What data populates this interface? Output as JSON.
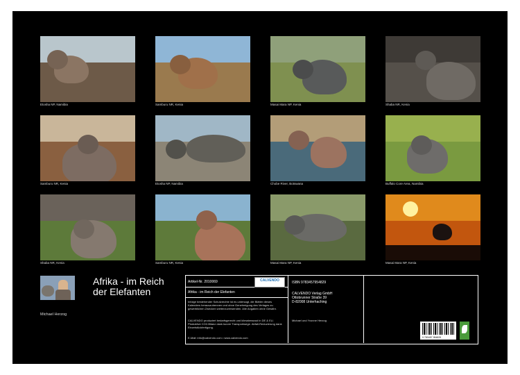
{
  "tiles": [
    {
      "caption": "Etosha NP, Namibia",
      "sky": "#b9c6cc",
      "ground": "#6d5a48",
      "ele": "#8b7563"
    },
    {
      "caption": "Samburu NR, Kenia",
      "sky": "#8fb6d6",
      "ground": "#9a7a4e",
      "ele": "#a0704a"
    },
    {
      "caption": "Masai Mara NP, Kenia",
      "sky": "#8fa07a",
      "ground": "#7f9050",
      "ele": "#585a5a"
    },
    {
      "caption": "Shaba NR, Kenia",
      "sky": "#3e3a36",
      "ground": "#55504a",
      "ele": "#6f6a64"
    },
    {
      "caption": "Samburu NR, Kenia",
      "sky": "#c9b69a",
      "ground": "#8a6040",
      "ele": "#7d6c62"
    },
    {
      "caption": "Etosha NP, Namibia",
      "sky": "#a0b7c6",
      "ground": "#8c8576",
      "ele": "#615f58"
    },
    {
      "caption": "Chobe River, Botswana",
      "sky": "#b39d78",
      "ground": "#4a6a7a",
      "ele": "#9c7360"
    },
    {
      "caption": "Buffalo Core Area, Namibia",
      "sky": "#98b04e",
      "ground": "#7a9a40",
      "ele": "#6e6c6a"
    },
    {
      "caption": "Shaba NR, Kenia",
      "sky": "#6a625a",
      "ground": "#5d7a3a",
      "ele": "#85796f"
    },
    {
      "caption": "Samburu NR, Kenia",
      "sky": "#8ab3cf",
      "ground": "#5e7a3a",
      "ele": "#a8735a"
    },
    {
      "caption": "Masai Mara NP, Kenia",
      "sky": "#8a9a6a",
      "ground": "#5a6a40",
      "ele": "#6a6a66"
    },
    {
      "caption": "Masai Mara NP, Kenia",
      "sky": "#e08a1c",
      "ground": "#c2560e",
      "ele": "#1b1210"
    }
  ],
  "author": {
    "name": "Michael Herzog"
  },
  "title": {
    "line1": "Afrika - im Reich",
    "line2": "der Elefanten"
  },
  "imprint": {
    "article": "Artikel-Nr. 2010069",
    "logo": "CALVENDO",
    "product_title": "Afrika - im Reich der Elefanten",
    "notice": "Infolge bestehender Schutzrechte ist es untersagt, die Blätter dieses Kalenders herauszutrennen und ohne Genehmigung des Verlages zu gewerblichen Zwecken weiterzuverwenden. Alle Angaben ohne Gewähr.",
    "eco": "CALVENDO produziert bedarfsgerecht und klimabewusst in DE & EU. Ptoduktive CO2-Bilanz dank kurzer Transportwege. Abfall-Reduzierung dank Einzelstückfertigung.",
    "contact": "E-Mail: info@calvendo.com • www.calvendo.com",
    "isbn": "ISBN 9783457954829",
    "publisher": "CALVENDO Verlag GmbH",
    "street": "Ottobrunner Straße 39",
    "city": "D-82008 Unterhaching",
    "authors": "Michael und Yvonne Herzog",
    "barcode_number": "9 783457 954829"
  }
}
